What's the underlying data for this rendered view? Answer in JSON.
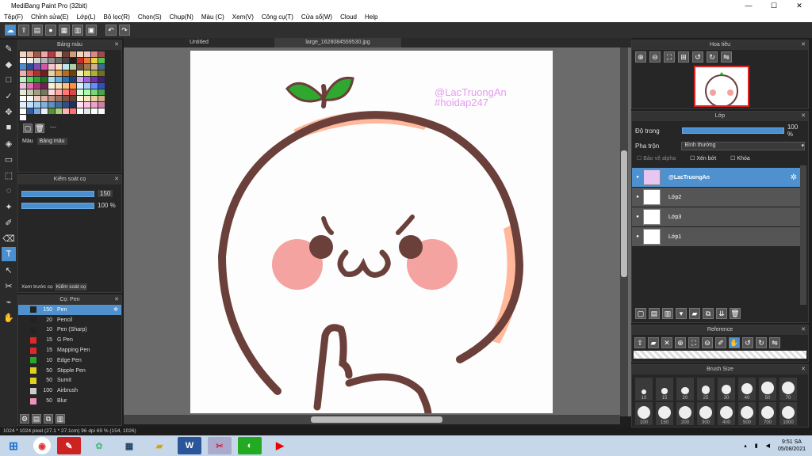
{
  "window": {
    "title": "MediBang Paint Pro (32bit)",
    "min": "—",
    "max": "☐",
    "close": "✕"
  },
  "menu": [
    "Tệp(F)",
    "Chỉnh sửa(E)",
    "Lớp(L)",
    "Bộ lọc(R)",
    "Chọn(S)",
    "Chụp(N)",
    "Màu (C)",
    "Xem(V)",
    "Công cụ(T)",
    "Cửa sổ(W)",
    "Cloud",
    "Help"
  ],
  "tabs": {
    "left": "Untitled",
    "active": "large_1628084559530.jpg"
  },
  "color_panel": {
    "title": "Bảng màu",
    "tab1": "Màu",
    "tab2": "Bảng màu",
    "dots": "---"
  },
  "brush_control": {
    "title": "Kiểm soát cọ",
    "size": "150",
    "opacity": "100 %",
    "tab1": "Xem trước cọ",
    "tab2": "Kiểm soát cọ"
  },
  "brush_panel": {
    "title": "Cọ: Pen",
    "items": [
      {
        "size": "150",
        "name": "Pen",
        "color": "#222222"
      },
      {
        "size": "20",
        "name": "Pencil",
        "color": "#222222"
      },
      {
        "size": "10",
        "name": "Pen (Sharp)",
        "color": "#222222"
      },
      {
        "size": "15",
        "name": "G Pen",
        "color": "#e02828"
      },
      {
        "size": "15",
        "name": "Mapping Pen",
        "color": "#e02828"
      },
      {
        "size": "10",
        "name": "Edge Pen",
        "color": "#28a828"
      },
      {
        "size": "50",
        "name": "Stipple Pen",
        "color": "#e0d020"
      },
      {
        "size": "50",
        "name": "Sumit",
        "color": "#e0d020"
      },
      {
        "size": "100",
        "name": "Airbrush",
        "color": "#cccccc"
      },
      {
        "size": "50",
        "name": "Blur",
        "color": "#f090c0"
      }
    ]
  },
  "navigator": {
    "title": "Hoa tiêu"
  },
  "layers": {
    "title": "Lớp",
    "opacity_label": "Độ trong",
    "opacity_value": "100 %",
    "blend_label": "Pha trộn",
    "blend_value": "Bình thường",
    "protect_alpha": "Bảo vệ alpha",
    "clipping": "Xén bớt",
    "lock": "Khóa",
    "items": [
      {
        "name": "@LacTruongAn"
      },
      {
        "name": "Lớp2"
      },
      {
        "name": "Lớp3"
      },
      {
        "name": "Lớp1"
      }
    ]
  },
  "reference": {
    "title": "Reference"
  },
  "brush_size": {
    "title": "Brush Size",
    "row1": [
      "10",
      "15",
      "20",
      "25",
      "30",
      "40",
      "50",
      "70"
    ],
    "row2": [
      "100",
      "150",
      "200",
      "300",
      "400",
      "500",
      "700",
      "1000"
    ]
  },
  "watermark": {
    "line1": "@LacTruongAn",
    "line2": "#hoidap247"
  },
  "status": "1024 * 1024 pixel  (27.1 * 27.1cm)  96 dpi  69 %  (154, 1026)",
  "clock": {
    "time": "9:51 SA",
    "date": "05/08/2021"
  },
  "colors": {
    "accent": "#4a8fd0",
    "line": "#6b3f3a",
    "cheek": "#f4a3a0",
    "leaf": "#2fa82f"
  }
}
